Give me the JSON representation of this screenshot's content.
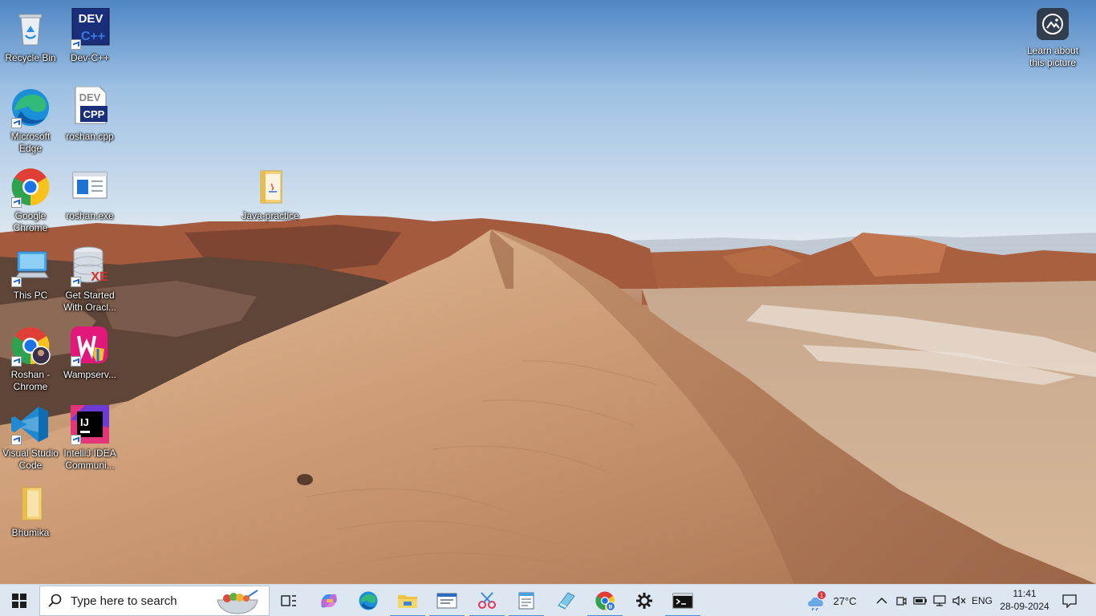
{
  "desktop": {
    "icons": [
      {
        "label": "Recycle Bin",
        "icon": "recycle-bin-icon"
      },
      {
        "label": "Dev-C++",
        "icon": "dev-cpp-icon"
      },
      {
        "label": "Microsoft Edge",
        "icon": "edge-icon"
      },
      {
        "label": "roshan.cpp",
        "icon": "cpp-file-icon"
      },
      {
        "label": "Google Chrome",
        "icon": "chrome-icon"
      },
      {
        "label": "roshan.exe",
        "icon": "exe-file-icon"
      },
      {
        "label": "Java-practice",
        "icon": "folder-icon"
      },
      {
        "label": "This PC",
        "icon": "this-pc-icon"
      },
      {
        "label": "Get Started With Oracl...",
        "icon": "oracle-xe-icon"
      },
      {
        "label": "Roshan - Chrome",
        "icon": "chrome-profile-icon"
      },
      {
        "label": "Wampserv...",
        "icon": "wampserver-icon"
      },
      {
        "label": "Visual Studio Code",
        "icon": "vscode-icon"
      },
      {
        "label": "IntelliJ IDEA Communi...",
        "icon": "intellij-icon"
      },
      {
        "label": "Bhumika",
        "icon": "folder-icon"
      }
    ],
    "spotlight": {
      "label": "Learn about this picture",
      "icon": "camera-info-icon"
    }
  },
  "taskbar": {
    "search_placeholder": "Type here to search",
    "apps": [
      {
        "name": "task-view",
        "icon": "task-view-icon"
      },
      {
        "name": "copilot",
        "icon": "copilot-icon"
      },
      {
        "name": "edge",
        "icon": "edge-icon"
      },
      {
        "name": "file-explorer",
        "icon": "file-explorer-icon"
      },
      {
        "name": "dev-tool",
        "icon": "app-window-icon"
      },
      {
        "name": "snipping-tool",
        "icon": "snipping-tool-icon"
      },
      {
        "name": "notepad",
        "icon": "notepad-icon"
      },
      {
        "name": "notes",
        "icon": "notes-icon"
      },
      {
        "name": "chrome",
        "icon": "chrome-icon"
      },
      {
        "name": "settings",
        "icon": "gear-icon"
      },
      {
        "name": "terminal",
        "icon": "terminal-icon"
      }
    ],
    "weather": {
      "temp": "27°C",
      "badge": "1"
    },
    "tray": {
      "language": "ENG"
    },
    "clock": {
      "time": "11:41",
      "date": "28-09-2024"
    }
  },
  "colors": {
    "accent": "#4a8bd6",
    "taskbar": "#dde7f2"
  }
}
